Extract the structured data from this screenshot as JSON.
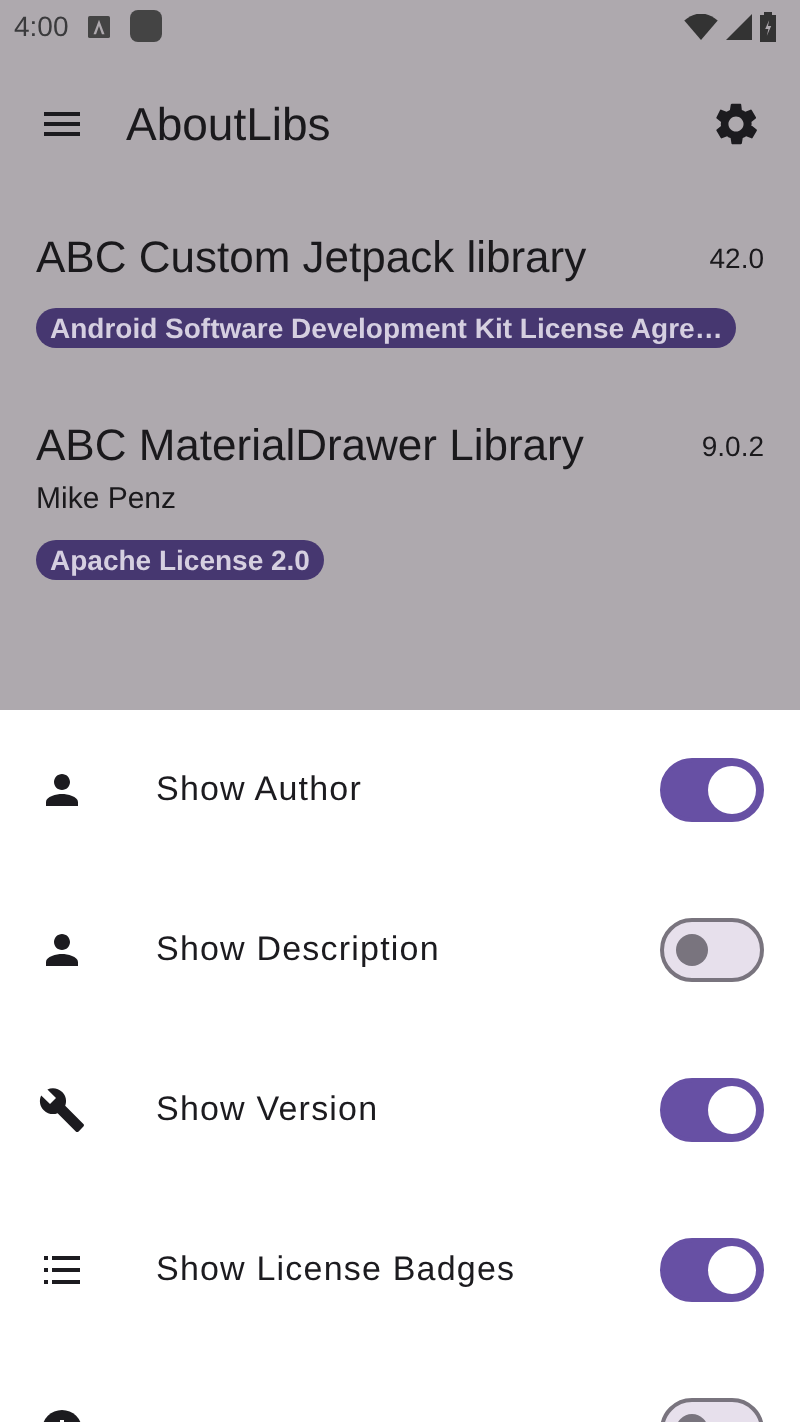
{
  "status_bar": {
    "time": "4:00"
  },
  "toolbar": {
    "title": "AboutLibs"
  },
  "libraries": [
    {
      "name": "ABC Custom Jetpack library",
      "version": "42.0",
      "licenses": [
        "Android Software Development Kit License Agre…"
      ]
    },
    {
      "name": "ABC MaterialDrawer Library",
      "version": "9.0.2",
      "author": "Mike Penz",
      "licenses": [
        "Apache License 2.0"
      ]
    }
  ],
  "settings_sheet": {
    "items": [
      {
        "label": "Show Author",
        "on": true
      },
      {
        "label": "Show Description",
        "on": false
      },
      {
        "label": "Show Version",
        "on": true
      },
      {
        "label": "Show License Badges",
        "on": true
      },
      {
        "on": false
      }
    ]
  }
}
